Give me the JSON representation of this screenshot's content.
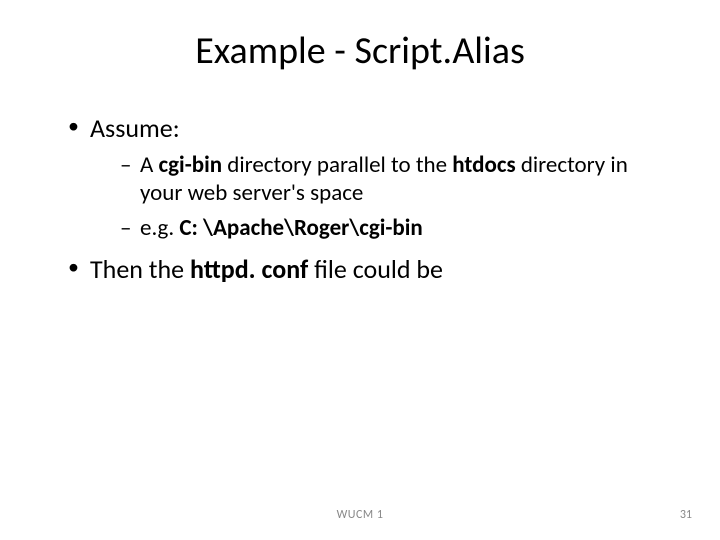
{
  "title": "Example - Script.Alias",
  "bullets": {
    "b1": "Assume:",
    "b1_sub1_pre": "A ",
    "b1_sub1_bold1": "cgi-bin",
    "b1_sub1_mid": " directory parallel to the ",
    "b1_sub1_bold2": "htdocs",
    "b1_sub1_post": " directory in your web server's space",
    "b1_sub2_pre": "e.g. ",
    "b1_sub2_bold": "C: \\Apache\\Roger\\cgi-bin",
    "b2_pre": "Then the ",
    "b2_bold": "httpd. conf",
    "b2_post": " file could be"
  },
  "footer": {
    "center": "WUCM 1",
    "page": "31"
  }
}
